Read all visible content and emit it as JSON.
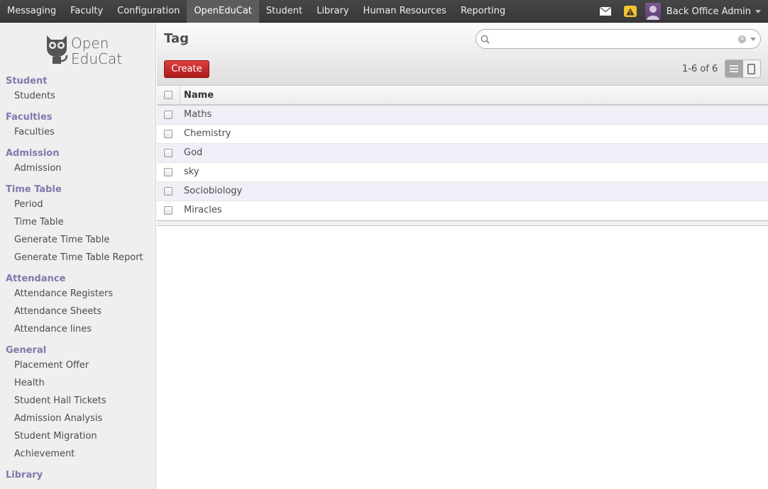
{
  "topbar": {
    "menu": [
      "Messaging",
      "Faculty",
      "Configuration",
      "OpenEduCat",
      "Student",
      "Library",
      "Human Resources",
      "Reporting"
    ],
    "active": "OpenEduCat",
    "user_name": "Back Office Admin"
  },
  "logo": {
    "line1": "Open",
    "line2": "EduCat"
  },
  "sidebar": {
    "sections": [
      {
        "title": "Student",
        "items": [
          "Students"
        ]
      },
      {
        "title": "Faculties",
        "items": [
          "Faculties"
        ]
      },
      {
        "title": "Admission",
        "items": [
          "Admission"
        ]
      },
      {
        "title": "Time Table",
        "items": [
          "Period",
          "Time Table",
          "Generate Time Table",
          "Generate Time Table Report"
        ]
      },
      {
        "title": "Attendance",
        "items": [
          "Attendance Registers",
          "Attendance Sheets",
          "Attendance lines"
        ]
      },
      {
        "title": "General",
        "items": [
          "Placement Offer",
          "Health",
          "Student Hall Tickets",
          "Admission Analysis",
          "Student Migration",
          "Achievement"
        ]
      },
      {
        "title": "Library",
        "items": []
      }
    ]
  },
  "main": {
    "title": "Tag",
    "search": {
      "value": "",
      "placeholder": ""
    },
    "create_label": "Create",
    "pager": "1-6 of 6",
    "table": {
      "header": "Name",
      "rows": [
        "Maths",
        "Chemistry",
        "God",
        "sky",
        "Sociobiology",
        "Miracles"
      ]
    }
  },
  "colors": {
    "accent": "#7c7bad",
    "create": "#c81f1f",
    "topbar": "#3e3e3e"
  }
}
